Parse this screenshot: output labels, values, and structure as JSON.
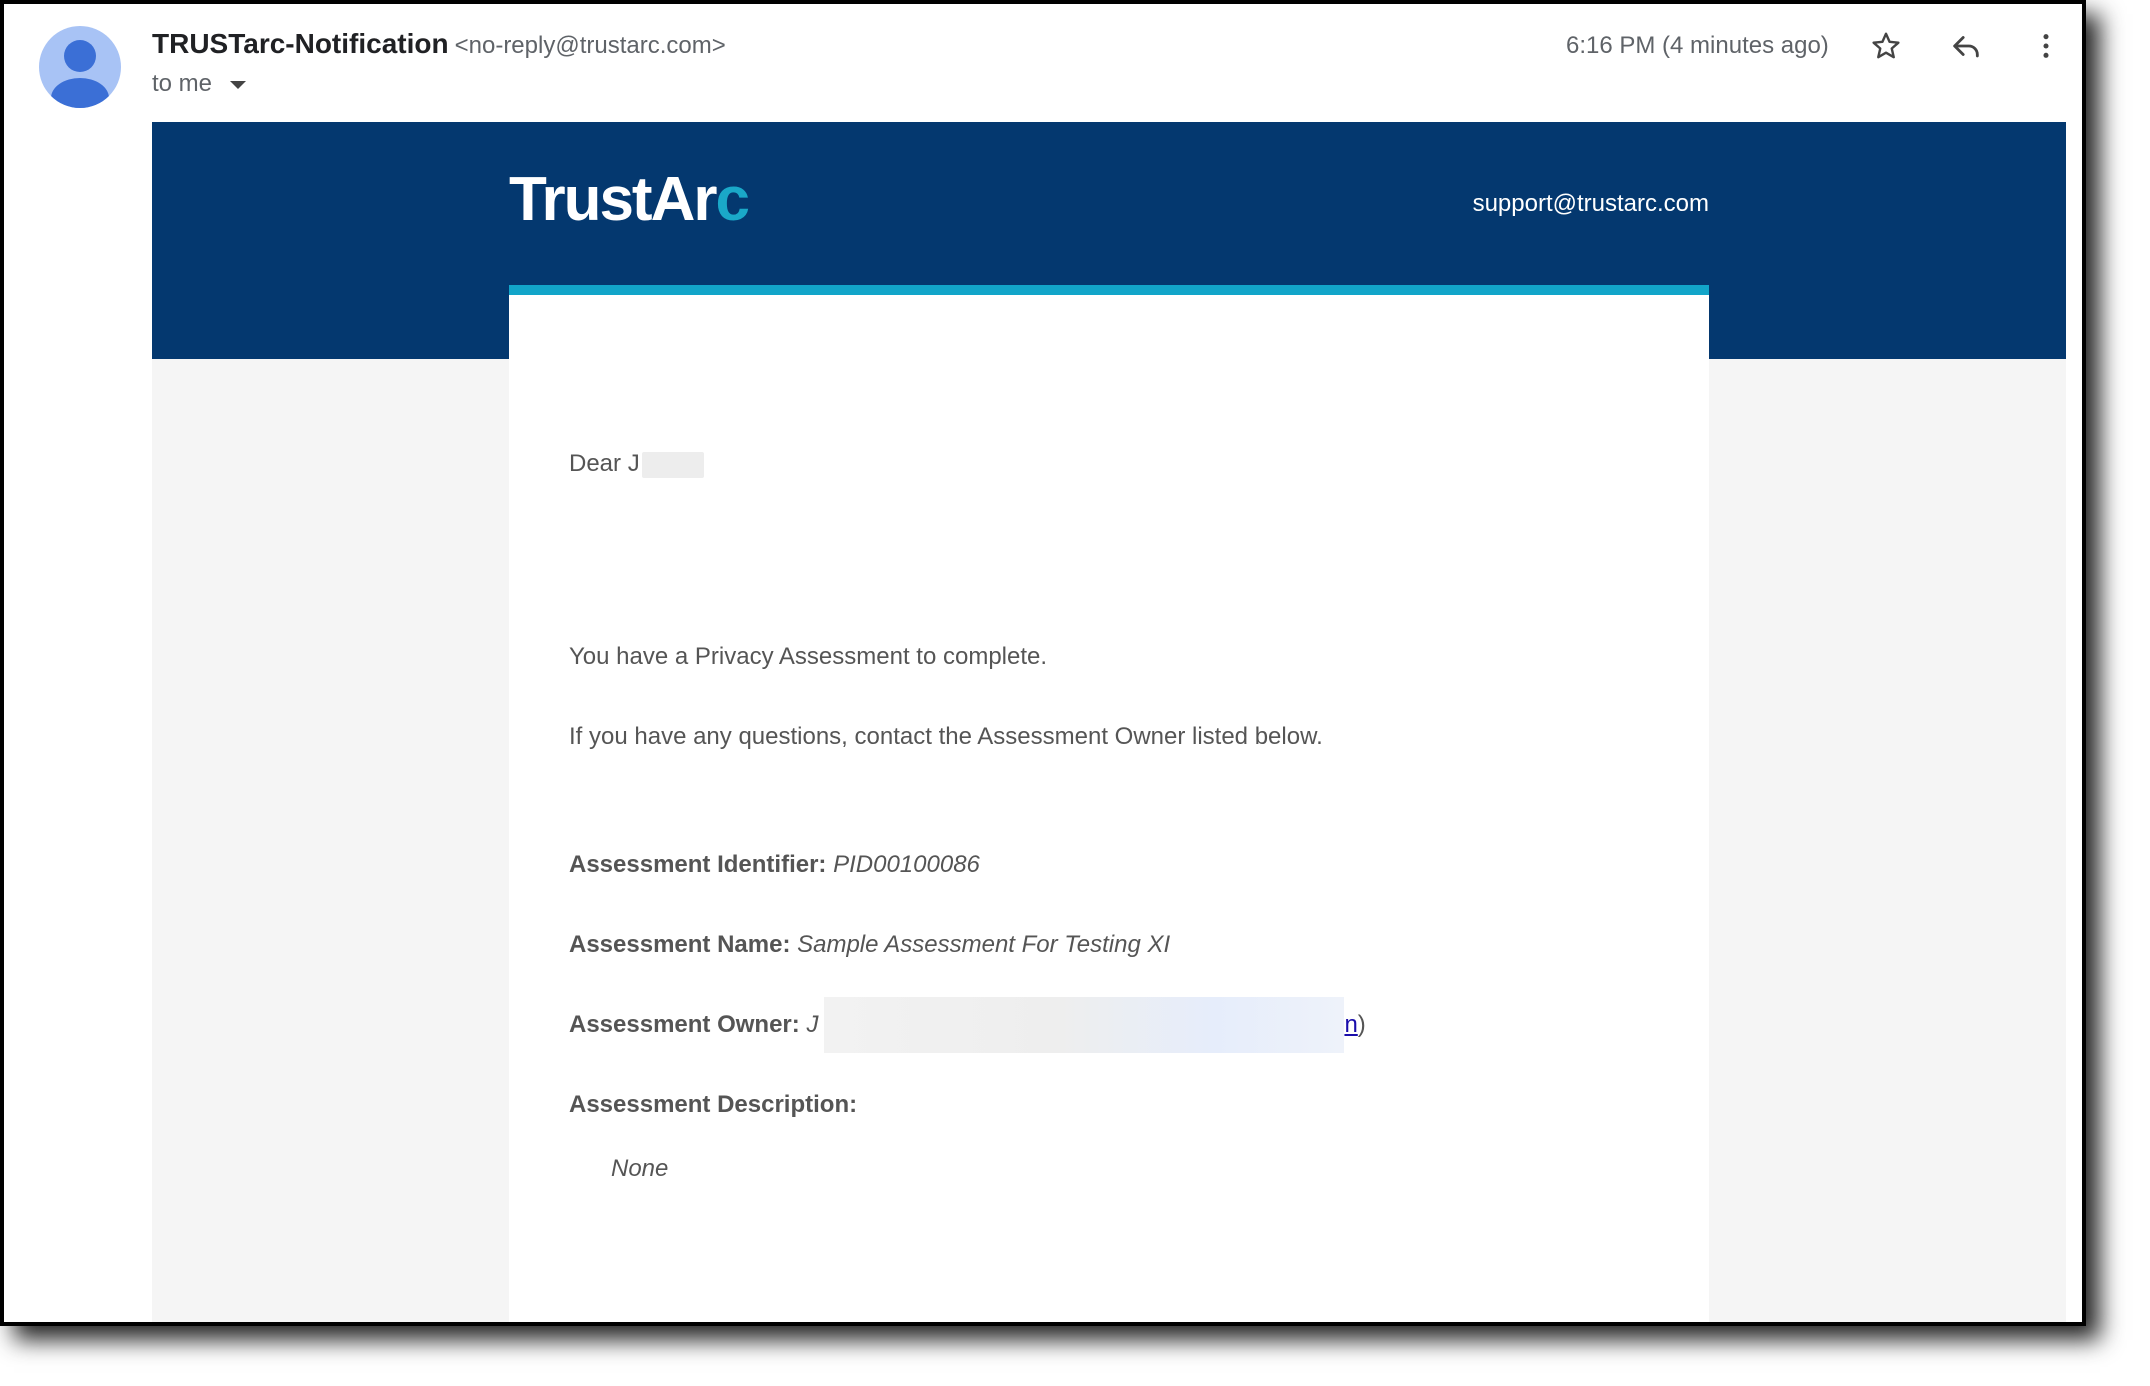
{
  "header": {
    "sender_name": "TRUSTarc-Notification",
    "sender_email": "<no-reply@trustarc.com>",
    "recipient": "to me",
    "timestamp": "6:16 PM (4 minutes ago)",
    "icons": [
      "avatar-icon",
      "star-icon",
      "reply-icon",
      "more-vert-icon",
      "chevron-down-icon"
    ]
  },
  "email": {
    "logo_main": "TrustAr",
    "logo_accent": "c",
    "support_email": "support@trustarc.com",
    "greeting": "Dear J",
    "line1": "You have a Privacy Assessment to complete.",
    "line2": "If you have any questions, contact the Assessment Owner listed below.",
    "identifier_label": "Assessment Identifier:",
    "identifier_value": "PID00100086",
    "name_label": "Assessment Name:",
    "name_value": "Sample Assessment For Testing XI",
    "owner_label": "Assessment Owner:",
    "owner_value_start": "J",
    "owner_value_end": ")",
    "owner_link_tail": "n",
    "description_label": "Assessment Description:",
    "description_value": "None"
  },
  "colors": {
    "banner": "#04386f",
    "accent": "#12a5c9",
    "avatar_bg": "#a8c3f5",
    "avatar_fg": "#3b6fd6"
  }
}
